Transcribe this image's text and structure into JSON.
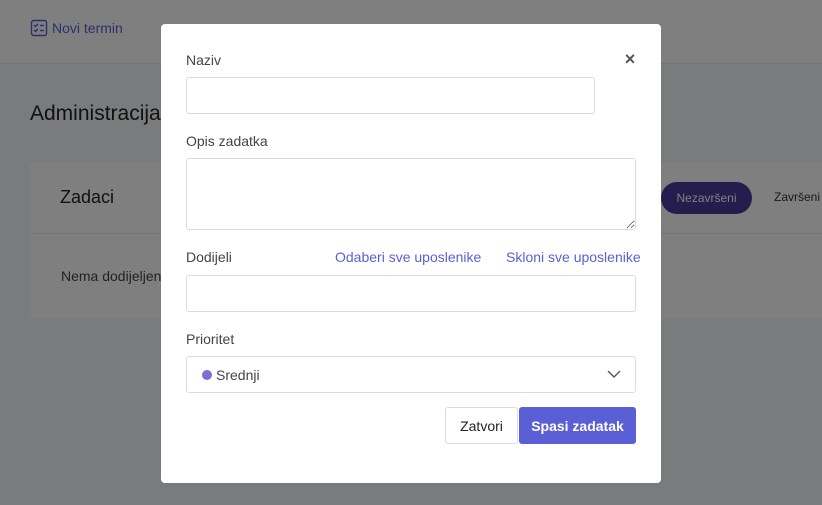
{
  "background": {
    "topbar": {
      "new_event_label": "Novi termin"
    },
    "page_title": "Administracija",
    "card": {
      "title": "Zadaci",
      "filter_active": "Nezavršeni",
      "filter_inactive": "Završeni",
      "empty_text": "Nema dodijeljenih"
    }
  },
  "modal": {
    "close_glyph": "×",
    "name_label": "Naziv",
    "name_value": "",
    "description_label": "Opis zadatka",
    "description_value": "",
    "assign_label": "Dodijeli",
    "select_all_link": "Odaberi sve uposlenike",
    "clear_all_link": "Skloni sve uposlenike",
    "assign_value": "",
    "priority_label": "Prioritet",
    "priority_selected": "Srednji",
    "priority_color": "#7b6fd0",
    "close_button": "Zatvori",
    "save_button": "Spasi zadatak"
  },
  "colors": {
    "accent": "#5b5fd6",
    "active_pill": "#4b3a9c"
  }
}
